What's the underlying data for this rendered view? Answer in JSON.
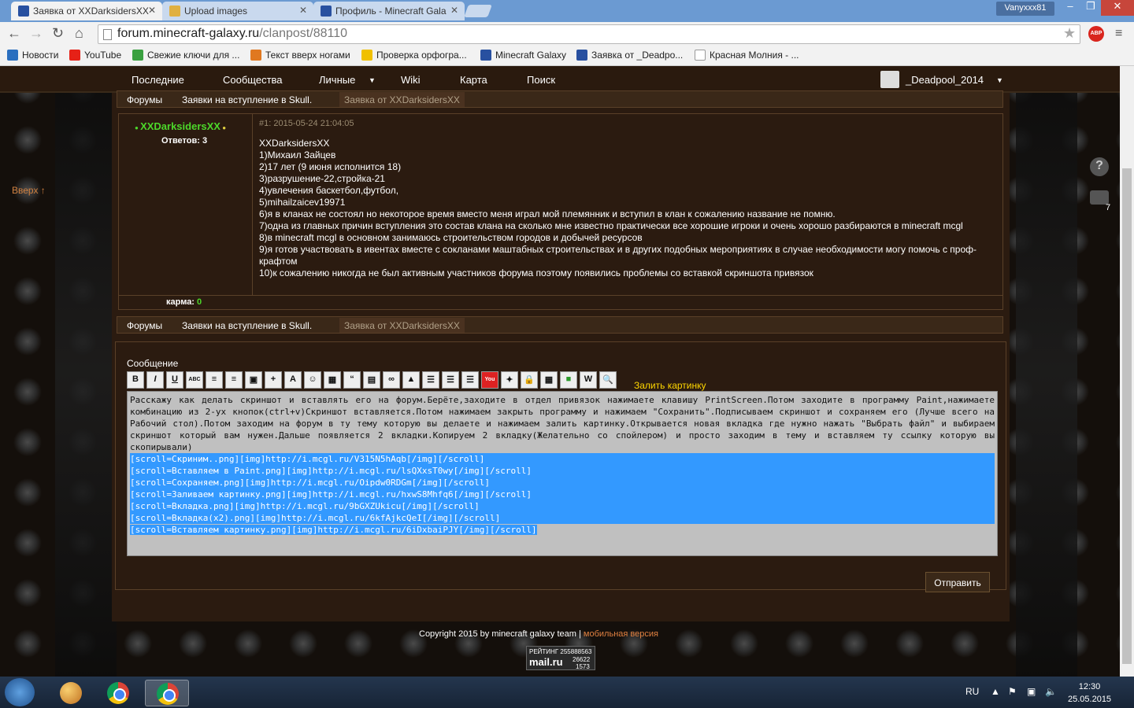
{
  "browser": {
    "tabs": [
      {
        "title": "Заявка от XXDarksidersXX",
        "active": true,
        "favicon_color": "#2850a0"
      },
      {
        "title": "Upload images",
        "active": false,
        "favicon_color": "#e0b040"
      },
      {
        "title": "Профиль - Minecraft Gala",
        "active": false,
        "favicon_color": "#2850a0"
      }
    ],
    "user": "Vanyxxx81",
    "url_host": "forum.minecraft-galaxy.ru",
    "url_path": "/clanpost/88110",
    "abp_label": "ABP",
    "bookmarks": [
      {
        "label": "Новости",
        "color": "#2a6fbf"
      },
      {
        "label": "YouTube",
        "color": "#e62117"
      },
      {
        "label": "Свежие ключи для ...",
        "color": "#3aa040"
      },
      {
        "label": "Текст вверх ногами",
        "color": "#e07820"
      },
      {
        "label": "Проверка орфогра...",
        "color": "#f0c000"
      },
      {
        "label": "Minecraft Galaxy",
        "color": "#2850a0"
      },
      {
        "label": "Заявка от _Deadpo...",
        "color": "#2850a0"
      },
      {
        "label": "Красная Молния - ...",
        "color": "#ffffff"
      }
    ]
  },
  "site": {
    "nav": [
      "Последние",
      "Сообщества",
      "Личные",
      "Wiki",
      "Карта",
      "Поиск"
    ],
    "nav_caret": "▼",
    "username": "_Deadpool_2014",
    "up_link": "Вверх ↑",
    "breadcrumbs": [
      "Форумы",
      "Заявки на вступление в Skull.",
      "Заявка от XXDarksidersXX"
    ],
    "post": {
      "author": "XXDarksidersXX",
      "replies_label": "Ответов: 3",
      "number": "#1",
      "date": "2015-05-24 21:04:05",
      "karma_label": "карма:",
      "karma_value": "0",
      "lines": [
        "XXDarksidersXX",
        "1)Михаил Зайцев",
        "2)17 лет (9 июня исполнится 18)",
        "3)разрушение-22,стройка-21",
        "4)увлечения баскетбол,футбол,",
        "5)mihailzaicev19971",
        "6)я в кланах не состоял но некоторое время вместо меня играл мой племянник и вступил в клан к сожалению название не помню.",
        "7)одна из главных причин вступления это состав клана на сколько мне известно практически все хорошие игроки и очень хорошо разбираются в minecraft mcgl",
        "8)в minecraft mcgl в основном занимаюсь строительством городов и добычей ресурсов",
        "9)я готов участвовать в ивентах вместе с сокланами маштабных строительствах и в других подобных мероприятиях в случае необходимости могу помочь с проф-крафтом",
        "10)к сожалению никогда не был активным участников форума поэтому появились проблемы со вставкой скриншота привязок"
      ]
    },
    "form": {
      "label": "Сообщение",
      "upload_link": "Залить картинку",
      "submit": "Отправить",
      "toolbar": [
        "B",
        "I",
        "U",
        "ABC",
        "≡",
        "≡",
        "▣",
        "+",
        "A",
        "☺",
        "▦",
        "“",
        "▤",
        "∞",
        "▲",
        "☰",
        "☰",
        "☰",
        "You",
        "✦",
        "🔒",
        "▦",
        "■",
        "W",
        "🔍"
      ],
      "text_plain": "Расскажу как делать скриншот и вставлять его на форум.Берёте,заходите в отдел привязок нажимаете клавишу PrintScreen.Потом заходите в программу Paint,нажимаете комбинацию из 2-ух кнопок(ctrl+v)Скриншот вставляется.Потом нажимаем закрыть программу и нажимаем \"Сохранить\".Подписываем скриншот и сохраняем его (Лучше всего на Рабочий стол).Потом заходим на форум в ту тему которую вы делаете и нажимаем залить картинку.Открывается новая вкладка где нужно нажать \"Выбрать файл\" и выбираем скриншот который вам нужен.Дальше появляется 2 вкладки.Копируем 2 вкладку(Желательно со спойлером) и просто заходим в тему и вставляем ту ссылку которую вы скопирывали)",
      "text_selected": [
        "[scroll=Скриним..png][img]http://i.mcgl.ru/V315N5hAqb[/img][/scroll]",
        "[scroll=Вставляем в Paint.png][img]http://i.mcgl.ru/lsQXxsT0wy[/img][/scroll]",
        "[scroll=Сохраняем.png][img]http://i.mcgl.ru/Oipdw0RDGm[/img][/scroll]",
        "[scroll=Заливаем картинку.png][img]http://i.mcgl.ru/hxwS8Mhfq6[/img][/scroll]",
        "[scroll=Вкладка.png][img]http://i.mcgl.ru/9bGXZUkicu[/img][/scroll]",
        "[scroll=Вкладка(x2).png][img]http://i.mcgl.ru/6kfAjkcQeI[/img][/scroll]",
        "[scroll=Вставляем картинку.png][img]http://i.mcgl.ru/6iDxbaiPJY[/img][/scroll]"
      ]
    },
    "footer_text": "Copyright 2015 by minecraft galaxy team |",
    "footer_mobile": "мобильная версия",
    "counter": {
      "line1": "РЕЙТИНГ 255888563",
      "brand": "mail.ru",
      "n1": "26622",
      "n2": "1573"
    },
    "side_count": "7"
  },
  "taskbar": {
    "lang": "RU",
    "time": "12:30",
    "date": "25.05.2015"
  }
}
